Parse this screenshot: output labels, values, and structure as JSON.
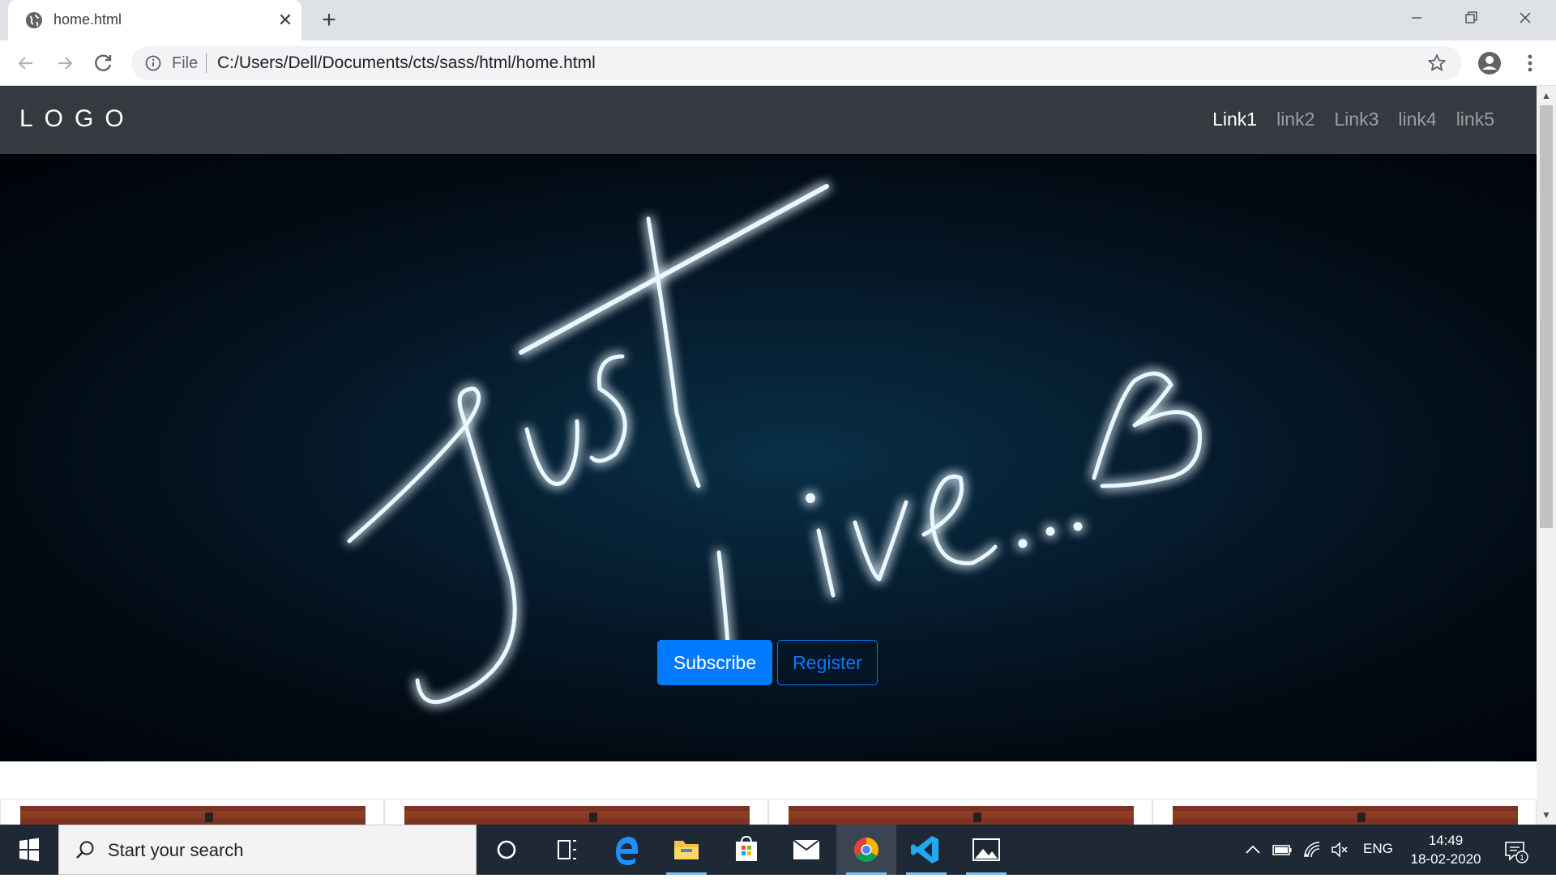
{
  "browser": {
    "tab_title": "home.html",
    "omnibox": {
      "scheme_label": "File",
      "url": "C:/Users/Dell/Documents/cts/sass/html/home.html"
    }
  },
  "site": {
    "logo": "LOGO",
    "nav_links": [
      "Link1",
      "link2",
      "Link3",
      "link4",
      "link5"
    ],
    "active_link_index": 0,
    "hero": {
      "script_text": "Just Live...",
      "subscribe_label": "Subscribe",
      "register_label": "Register",
      "accent_color": "#007bff"
    }
  },
  "taskbar": {
    "search_placeholder": "Start your search",
    "language": "ENG",
    "time": "14:49",
    "date": "18-02-2020",
    "notification_count": "1"
  }
}
